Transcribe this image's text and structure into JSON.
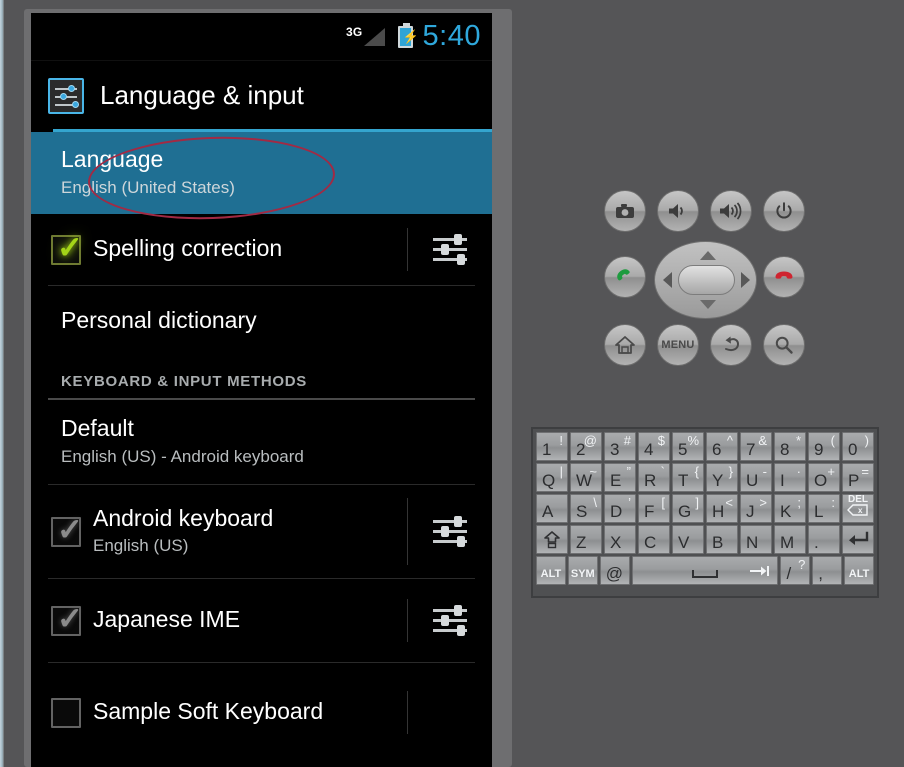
{
  "phone": {
    "status_bar": {
      "network_label": "3G",
      "signal_icon": "signal-triangle-icon",
      "battery_icon": "battery-charging-icon",
      "battery_bolt": "⚡",
      "time": "5:40",
      "time_color": "#2fa8dc"
    },
    "title_bar": {
      "icon": "settings-sliders-icon",
      "title": "Language & input",
      "accent_color": "#34a5cf"
    },
    "list": {
      "highlight_color": "#1f6f93",
      "rows": [
        {
          "name": "language",
          "title": "Language",
          "subtitle": "English (United States)",
          "highlighted": true,
          "checkbox": null,
          "gear": false
        },
        {
          "name": "spelling-correction",
          "title": "Spelling correction",
          "subtitle": "",
          "highlighted": false,
          "checkbox": "checked-bright",
          "gear": true
        },
        {
          "name": "personal-dictionary",
          "title": "Personal dictionary",
          "subtitle": "",
          "highlighted": false,
          "checkbox": null,
          "gear": false
        }
      ],
      "section_header": "KEYBOARD & INPUT METHODS",
      "default_row": {
        "name": "default",
        "title": "Default",
        "subtitle": "English (US) - Android keyboard"
      },
      "ime_rows": [
        {
          "name": "android-keyboard",
          "title": "Android keyboard",
          "subtitle": "English (US)",
          "checkbox": "checked-dim",
          "gear": true
        },
        {
          "name": "japanese-ime",
          "title": "Japanese IME",
          "subtitle": "",
          "checkbox": "checked-dim",
          "gear": true
        },
        {
          "name": "sample-soft-keyboard",
          "title": "Sample Soft Keyboard",
          "subtitle": "",
          "checkbox": "unchecked",
          "gear": true
        }
      ]
    }
  },
  "annotation": {
    "shape": "ellipse",
    "color": "#a22a44",
    "target": "Language"
  },
  "emulator_controls": {
    "buttons": [
      {
        "name": "camera-button",
        "icon": "camera-icon"
      },
      {
        "name": "volume-down-button",
        "icon": "speaker-low-icon"
      },
      {
        "name": "volume-up-button",
        "icon": "speaker-high-icon"
      },
      {
        "name": "power-button",
        "icon": "power-icon"
      },
      {
        "name": "call-button",
        "icon": "phone-green-icon"
      },
      {
        "name": "end-call-button",
        "icon": "phone-red-icon"
      },
      {
        "name": "home-button",
        "icon": "home-icon"
      },
      {
        "name": "menu-button",
        "icon": "menu-text-icon",
        "label": "MENU"
      },
      {
        "name": "back-button",
        "icon": "back-arrow-icon"
      },
      {
        "name": "search-button",
        "icon": "magnifier-icon"
      }
    ],
    "dpad": {
      "name": "dpad",
      "up": "dpad-up",
      "down": "dpad-down",
      "left": "dpad-left",
      "right": "dpad-right",
      "center": "dpad-center"
    }
  },
  "keyboard": {
    "rows": [
      [
        {
          "main": "1",
          "sup": "!"
        },
        {
          "main": "2",
          "sup": "@"
        },
        {
          "main": "3",
          "sup": "#"
        },
        {
          "main": "4",
          "sup": "$"
        },
        {
          "main": "5",
          "sup": "%"
        },
        {
          "main": "6",
          "sup": "^"
        },
        {
          "main": "7",
          "sup": "&"
        },
        {
          "main": "8",
          "sup": "*"
        },
        {
          "main": "9",
          "sup": "("
        },
        {
          "main": "0",
          "sup": ")"
        }
      ],
      [
        {
          "main": "Q",
          "sup": "|"
        },
        {
          "main": "W",
          "sup": "~"
        },
        {
          "main": "E",
          "sup": "”"
        },
        {
          "main": "R",
          "sup": "`"
        },
        {
          "main": "T",
          "sup": "{"
        },
        {
          "main": "Y",
          "sup": "}"
        },
        {
          "main": "U",
          "sup": "-"
        },
        {
          "main": "I",
          "sup": "·"
        },
        {
          "main": "O",
          "sup": "+"
        },
        {
          "main": "P",
          "sup": "="
        }
      ],
      [
        {
          "main": "A",
          "sup": ""
        },
        {
          "main": "S",
          "sup": "\\"
        },
        {
          "main": "D",
          "sup": "’"
        },
        {
          "main": "F",
          "sup": "["
        },
        {
          "main": "G",
          "sup": "]"
        },
        {
          "main": "H",
          "sup": "<"
        },
        {
          "main": "J",
          "sup": ">"
        },
        {
          "main": "K",
          "sup": ";"
        },
        {
          "main": "L",
          "sup": ":"
        },
        {
          "type": "del",
          "label": "DEL",
          "glyph": "backspace-icon"
        }
      ],
      [
        {
          "type": "shift",
          "glyph": "shift-icon"
        },
        {
          "main": "Z",
          "sup": ""
        },
        {
          "main": "X",
          "sup": ""
        },
        {
          "main": "C",
          "sup": ""
        },
        {
          "main": "V",
          "sup": ""
        },
        {
          "main": "B",
          "sup": ""
        },
        {
          "main": "N",
          "sup": ""
        },
        {
          "main": "M",
          "sup": ""
        },
        {
          "main": ".",
          "sup": ""
        },
        {
          "type": "enter",
          "glyph": "enter-icon"
        }
      ],
      [
        {
          "type": "lbl",
          "label": "ALT"
        },
        {
          "type": "lbl",
          "label": "SYM"
        },
        {
          "main": "@",
          "sup": ""
        },
        {
          "type": "space",
          "glyph": "space-icon",
          "tab": "tab-icon"
        },
        {
          "main": "/",
          "sup": "?"
        },
        {
          "main": ",",
          "sup": ""
        },
        {
          "type": "lbl",
          "label": "ALT"
        }
      ]
    ]
  }
}
